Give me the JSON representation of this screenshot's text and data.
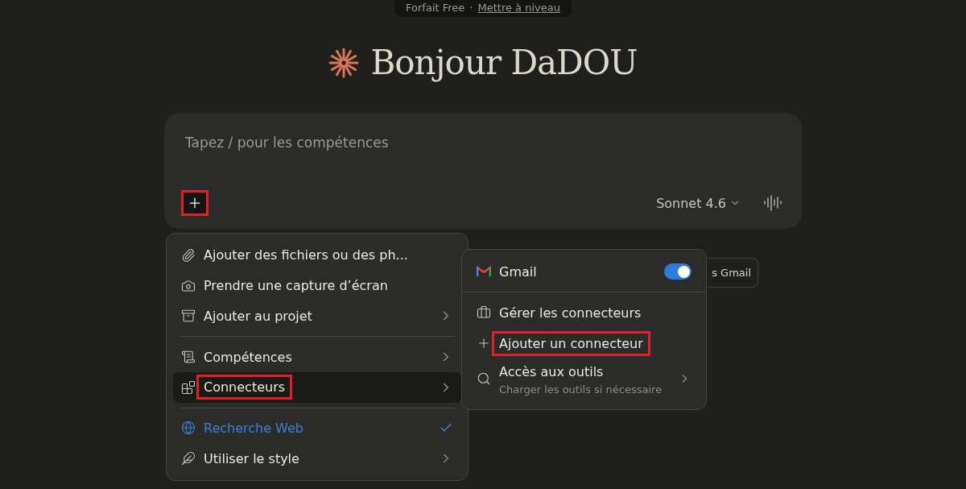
{
  "plan_banner": {
    "plan": "Forfait Free",
    "separator": "·",
    "upgrade_link": "Mettre à niveau"
  },
  "greeting": "Bonjour DaDOU",
  "composer": {
    "placeholder": "Tapez / pour les compétences",
    "plus_highlighted": true,
    "model": "Sonnet 4.6"
  },
  "background_chip": "s Gmail",
  "menu": {
    "items": [
      {
        "kind": "item",
        "label": "Ajouter des fichiers ou des ph...",
        "submenu": false,
        "active": false,
        "highlighted": false,
        "checked": false
      },
      {
        "kind": "item",
        "label": "Prendre une capture d’écran",
        "submenu": false,
        "active": false,
        "highlighted": false,
        "checked": false
      },
      {
        "kind": "item",
        "label": "Ajouter au projet",
        "submenu": true,
        "active": false,
        "highlighted": false,
        "checked": false
      },
      {
        "kind": "divider"
      },
      {
        "kind": "item",
        "label": "Compétences",
        "submenu": true,
        "active": false,
        "highlighted": false,
        "checked": false
      },
      {
        "kind": "item",
        "label": "Connecteurs",
        "submenu": true,
        "active": true,
        "highlighted": true,
        "checked": false
      },
      {
        "kind": "divider"
      },
      {
        "kind": "item",
        "label": "Recherche Web",
        "submenu": false,
        "active": false,
        "highlighted": false,
        "checked": true
      },
      {
        "kind": "item",
        "label": "Utiliser le style",
        "submenu": true,
        "active": false,
        "highlighted": false,
        "checked": false
      }
    ]
  },
  "submenu": {
    "items": [
      {
        "kind": "toggle",
        "label": "Gmail",
        "on": true
      },
      {
        "kind": "divider"
      },
      {
        "kind": "item",
        "label": "Gérer les connecteurs",
        "highlighted": false,
        "submenu": false
      },
      {
        "kind": "item",
        "label": "Ajouter un connecteur",
        "highlighted": true,
        "submenu": false
      },
      {
        "kind": "item",
        "label": "Accès aux outils",
        "description": "Charger les outils si nécessaire",
        "highlighted": false,
        "submenu": true
      }
    ]
  }
}
